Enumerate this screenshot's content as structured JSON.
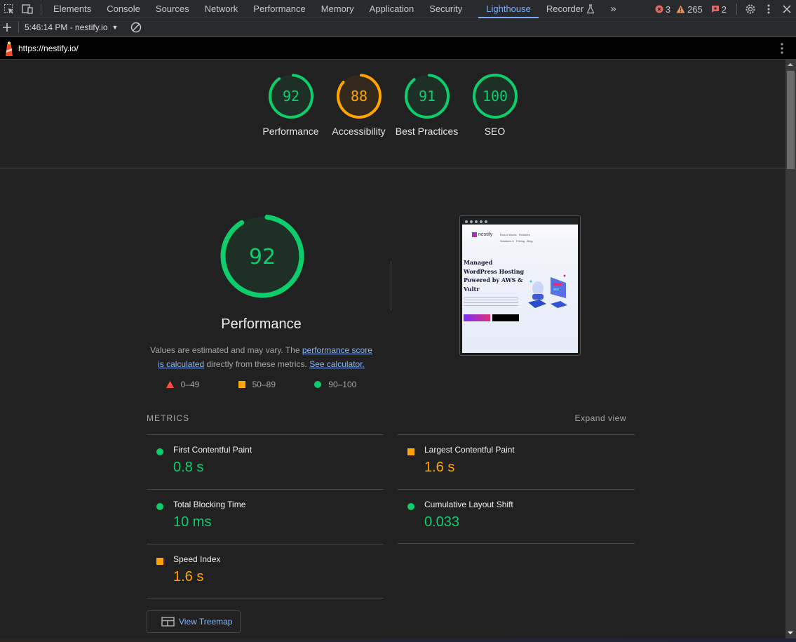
{
  "devtools": {
    "tabs": [
      "Elements",
      "Console",
      "Sources",
      "Network",
      "Performance",
      "Memory",
      "Application",
      "Security",
      "Lighthouse",
      "Recorder"
    ],
    "active_tab": "Lighthouse",
    "more_tabs_icon": "chevron-double-right",
    "counts": {
      "errors": "3",
      "warnings": "265",
      "issues": "2"
    },
    "report_selector": "5:46:14 PM - nestify.io",
    "url": "https://nestify.io/"
  },
  "categories": [
    {
      "name": "Performance",
      "score": 92,
      "status": "pass"
    },
    {
      "name": "Accessibility",
      "score": 88,
      "status": "average"
    },
    {
      "name": "Best Practices",
      "score": 91,
      "status": "pass"
    },
    {
      "name": "SEO",
      "score": 100,
      "status": "pass"
    }
  ],
  "performance": {
    "score": "92",
    "score_fraction": 0.92,
    "title": "Performance",
    "desc_prefix": "Values are estimated and may vary. The ",
    "link1": "performance score is calculated",
    "desc_mid": " directly from these metrics. ",
    "link2": "See calculator.",
    "legend": [
      "0–49",
      "50–89",
      "90–100"
    ]
  },
  "screenshot": {
    "logo_text": "nestify",
    "nav": [
      "How it Works",
      "Features",
      "Solutions ▾",
      "Pricing",
      "Blog"
    ],
    "headline": "Managed WordPress Hosting Powered by AWS & Vultr",
    "btn1": "Plans & Pricing",
    "btn2": "Start FREE 7 Day Trial"
  },
  "metrics": {
    "heading": "METRICS",
    "expand": "Expand view",
    "items": [
      {
        "name": "First Contentful Paint",
        "value": "0.8 s",
        "status": "pass"
      },
      {
        "name": "Largest Contentful Paint",
        "value": "1.6 s",
        "status": "average"
      },
      {
        "name": "Total Blocking Time",
        "value": "10 ms",
        "status": "pass"
      },
      {
        "name": "Cumulative Layout Shift",
        "value": "0.033",
        "status": "pass"
      },
      {
        "name": "Speed Index",
        "value": "1.6 s",
        "status": "average"
      }
    ]
  },
  "treemap_label": "View Treemap",
  "colors": {
    "pass": "#0cce6b",
    "average": "#ffa400",
    "fail": "#ff4e42",
    "link": "#8ab4f8"
  }
}
